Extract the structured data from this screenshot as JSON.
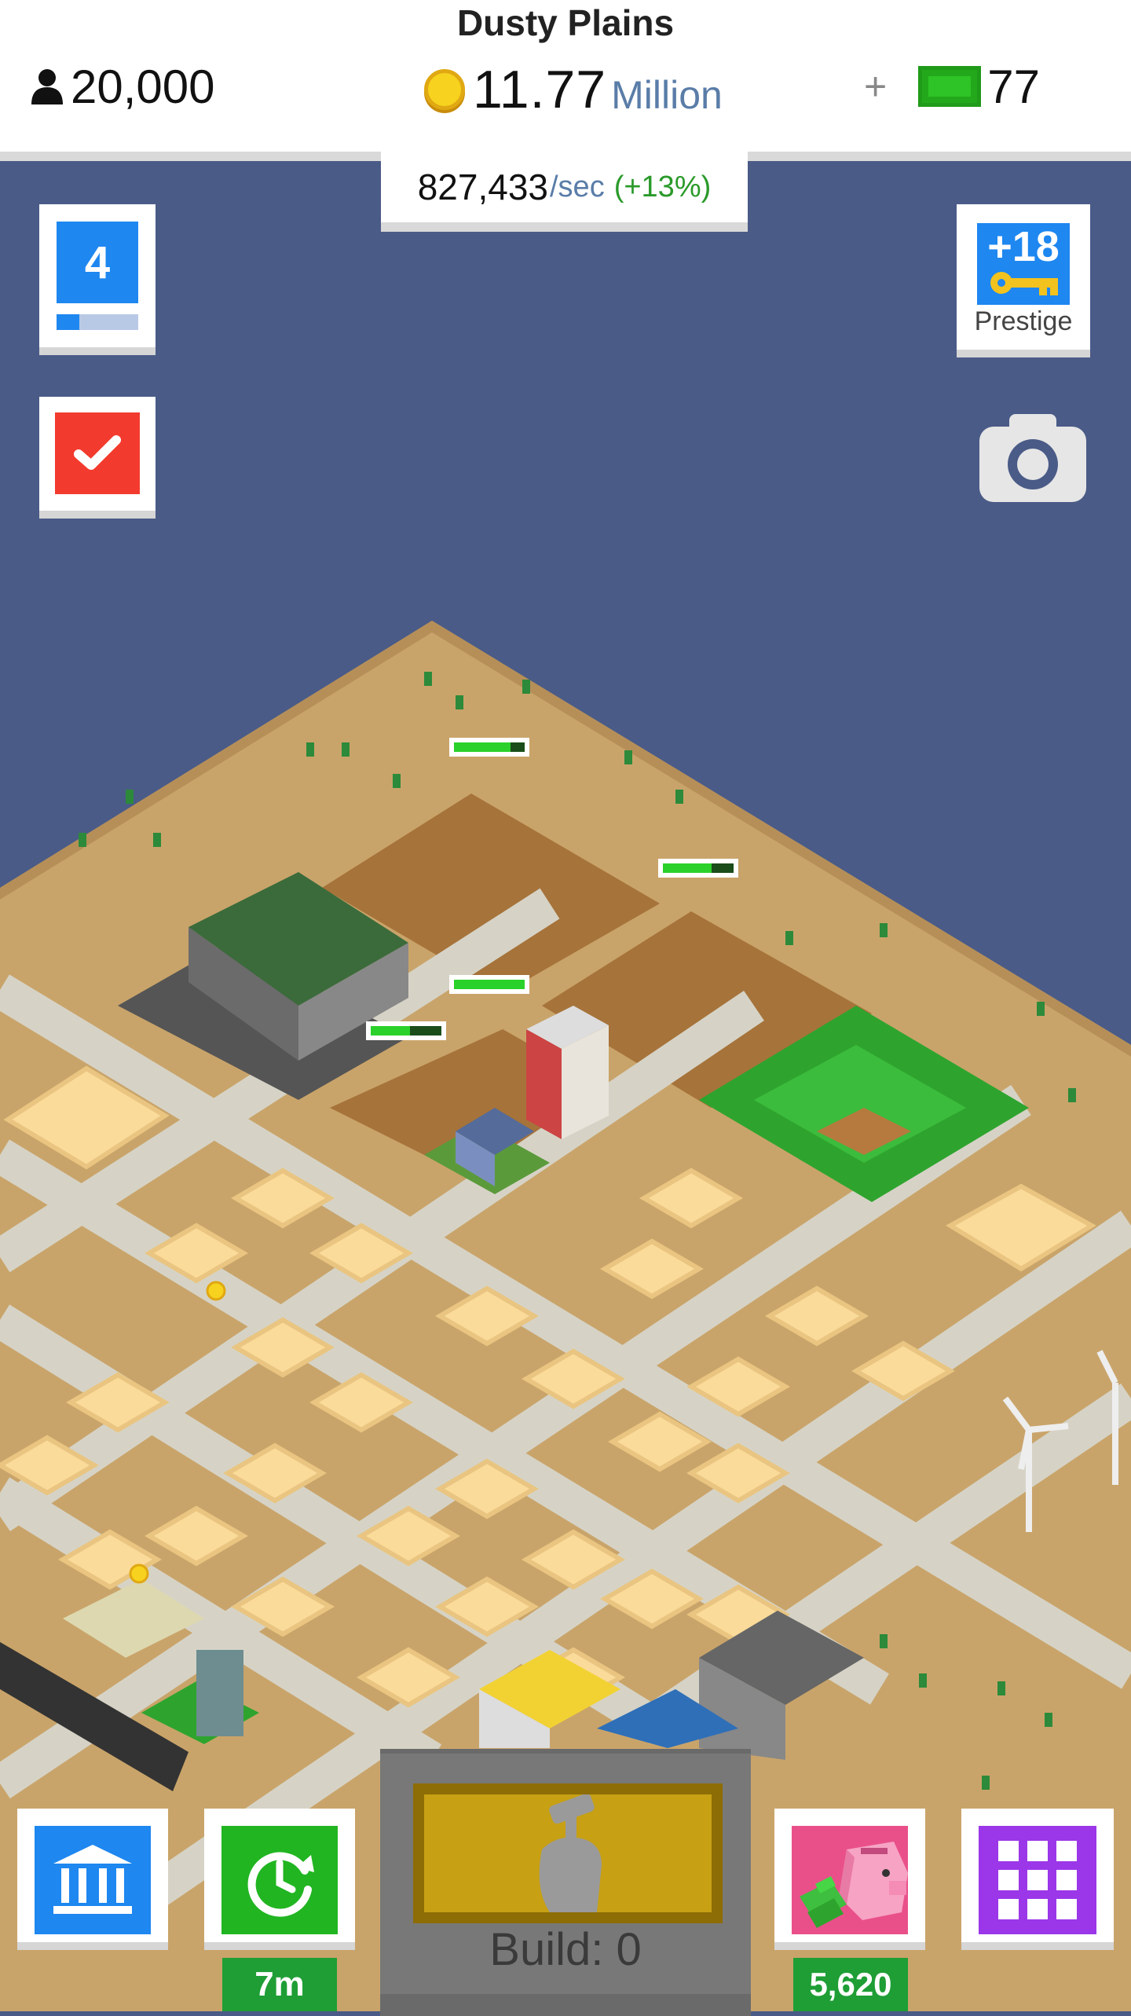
{
  "header": {
    "city_name": "Dusty Plains",
    "population": "20,000",
    "money_value": "11.77",
    "money_unit": "Million",
    "plus_label": "+",
    "gems": "77"
  },
  "income": {
    "rate": "827,433",
    "unit": "/sec",
    "bonus": "(+13%)"
  },
  "level": {
    "number": "4",
    "progress": 0.28
  },
  "prestige": {
    "keys": "+18",
    "label": "Prestige"
  },
  "bottom_bar": {
    "boost_timer": "7m",
    "piggy_bank_value": "5,620",
    "build_label": "Build: 0"
  },
  "icons": {
    "population": "person-icon",
    "money": "coin-icon",
    "gems": "green-bill-icon",
    "tasks": "checkmark-icon",
    "camera": "camera-icon",
    "bank": "bank-icon",
    "boost": "clock-refresh-icon",
    "piggy": "piggy-bank-icon",
    "menu": "grid-icon",
    "build": "hammer-hand-icon"
  },
  "colors": {
    "background": "#4a5b87",
    "sand": "#c9a46a",
    "road": "#d6d3c6",
    "blue_accent": "#1e87f0",
    "green_accent": "#21b521",
    "red_accent": "#f23b2e",
    "purple_accent": "#9b37e8",
    "pink_accent": "#e9508a",
    "money_unit": "#5a7da8"
  }
}
